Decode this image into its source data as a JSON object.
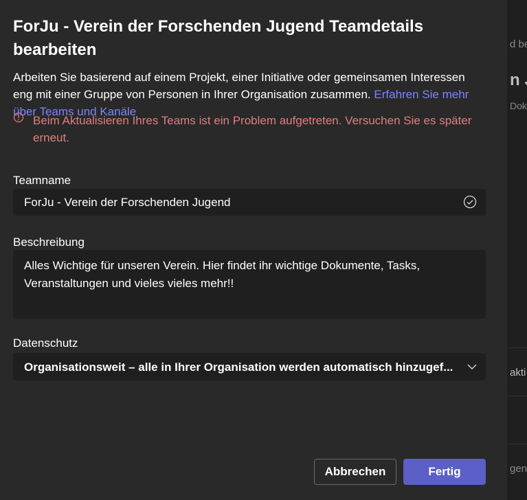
{
  "dialog": {
    "title": "ForJu - Verein der Forschenden Jugend Teamdetails bearbeiten",
    "intro_text": "Arbeiten Sie basierend auf einem Projekt, einer Initiative oder gemeinsamen Interessen eng mit einer Gruppe von Personen in Ihrer Organisation zusammen. ",
    "intro_link": "Erfahren Sie mehr über Teams und Kanäle",
    "error_message": "Beim Aktualisieren Ihres Teams ist ein Problem aufgetreten. Versuchen Sie es später erneut."
  },
  "form": {
    "teamname_label": "Teamname",
    "teamname_value": "ForJu - Verein der Forschenden Jugend",
    "description_label": "Beschreibung",
    "description_value": "Alles Wichtige für unseren Verein. Hier findet ihr wichtige Dokumente, Tasks, Veranstaltungen und vieles vieles mehr!!",
    "privacy_label": "Datenschutz",
    "privacy_value": "Organisationsweit – alle in Ihrer Organisation werden automatisch hinzugef..."
  },
  "buttons": {
    "cancel": "Abbrechen",
    "done": "Fertig"
  },
  "background": {
    "fragment_1": "d be",
    "fragment_2": "n J",
    "fragment_3": "Dok",
    "fragment_4": "akti",
    "fragment_5": "gen v"
  },
  "colors": {
    "dialog_bg": "#292929",
    "field_bg": "#1f1f1f",
    "accent": "#5b5fc7",
    "link": "#7f85f5",
    "error": "#e37d80"
  },
  "icons": {
    "error": "error-circle-icon",
    "valid": "checkmark-circle-icon",
    "dropdown": "chevron-down-icon"
  }
}
